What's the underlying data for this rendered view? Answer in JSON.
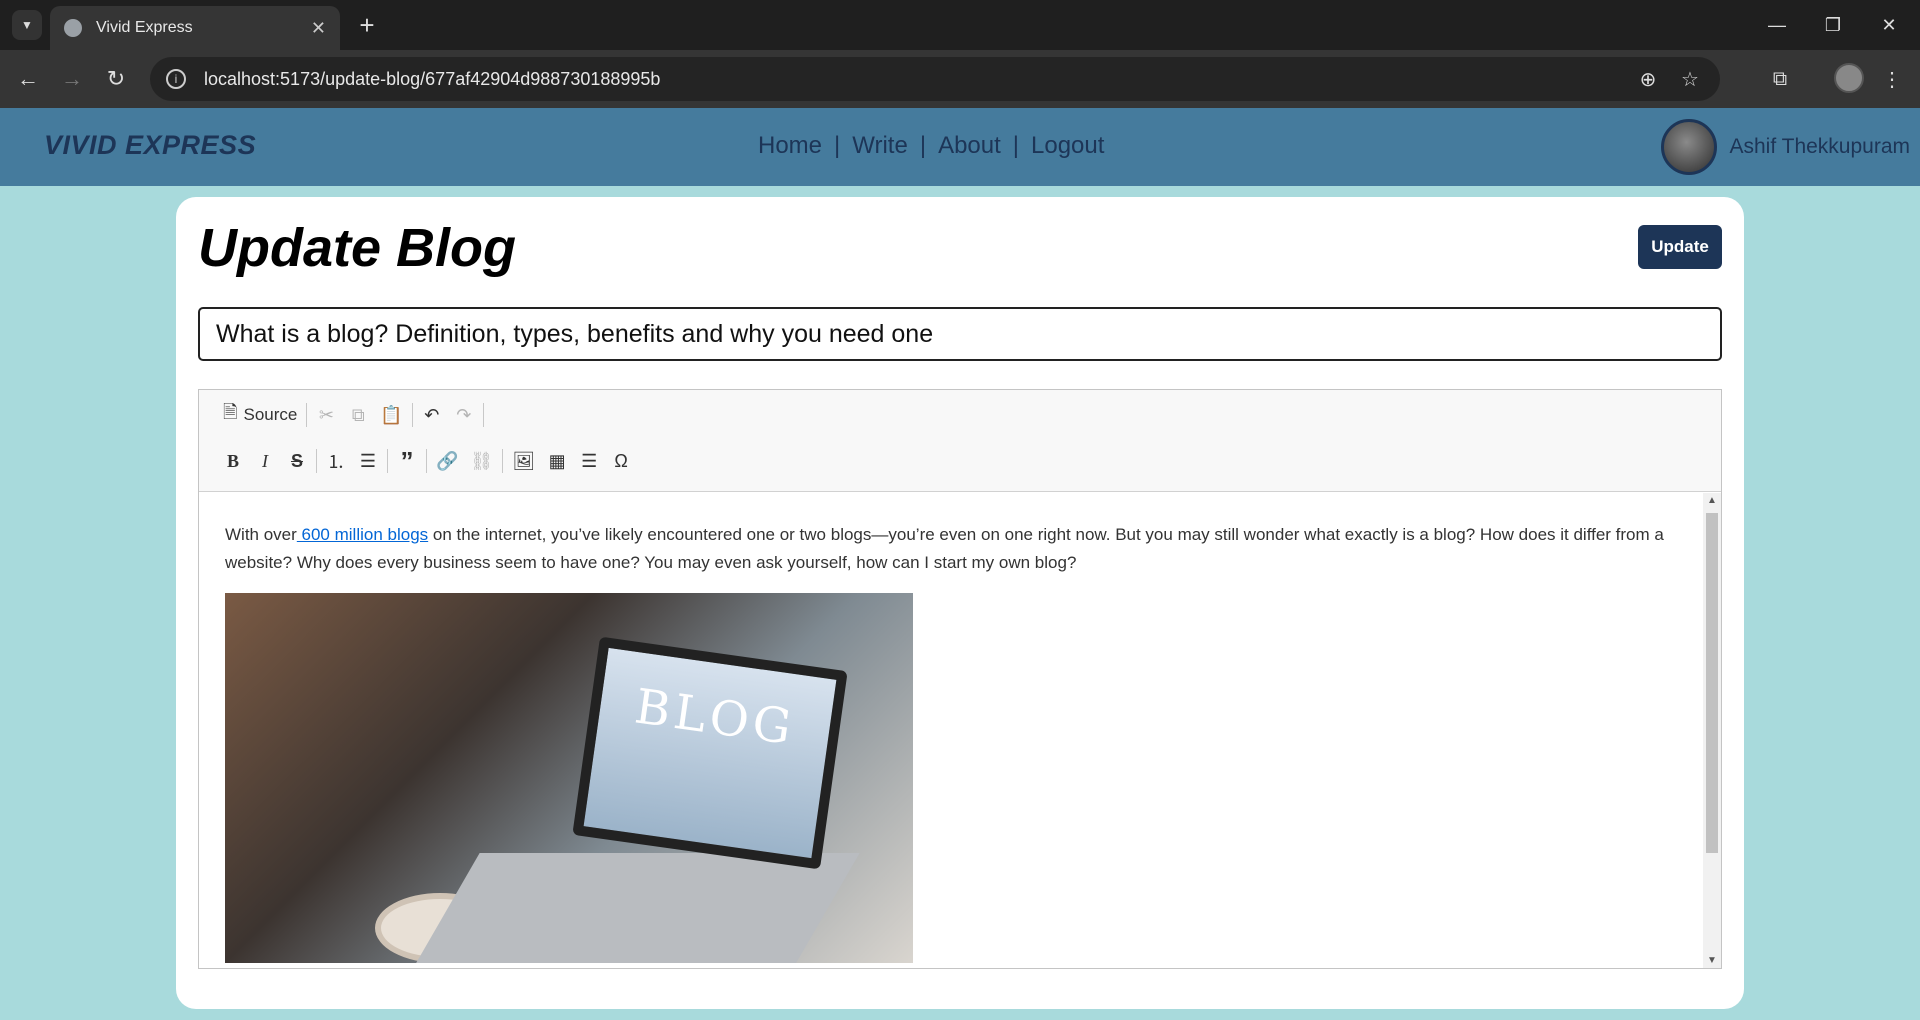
{
  "browser": {
    "tab_title": "Vivid Express",
    "url": "localhost:5173/update-blog/677af42904d988730188995b"
  },
  "header": {
    "logo": "VIVID EXPRESS",
    "nav": [
      {
        "label": "Home"
      },
      {
        "label": "Write"
      },
      {
        "label": "About"
      },
      {
        "label": "Logout"
      }
    ],
    "user_name": "Ashif Thekkupuram"
  },
  "page": {
    "title": "Update Blog",
    "update_label": "Update",
    "blog_title": "What is a blog? Definition, types, benefits and why you need one"
  },
  "editor": {
    "source_label": "Source",
    "content_before_link": "With over",
    "content_link": " 600 million blogs",
    "content_after_link": " on the internet, you’ve likely encountered one or two blogs—you’re even on one right now. But you may still wonder what exactly is a blog? How does it differ from a website? Why does every business seem to have one? You may even ask yourself, how can I start my own blog?",
    "image_text": "BLOG"
  }
}
